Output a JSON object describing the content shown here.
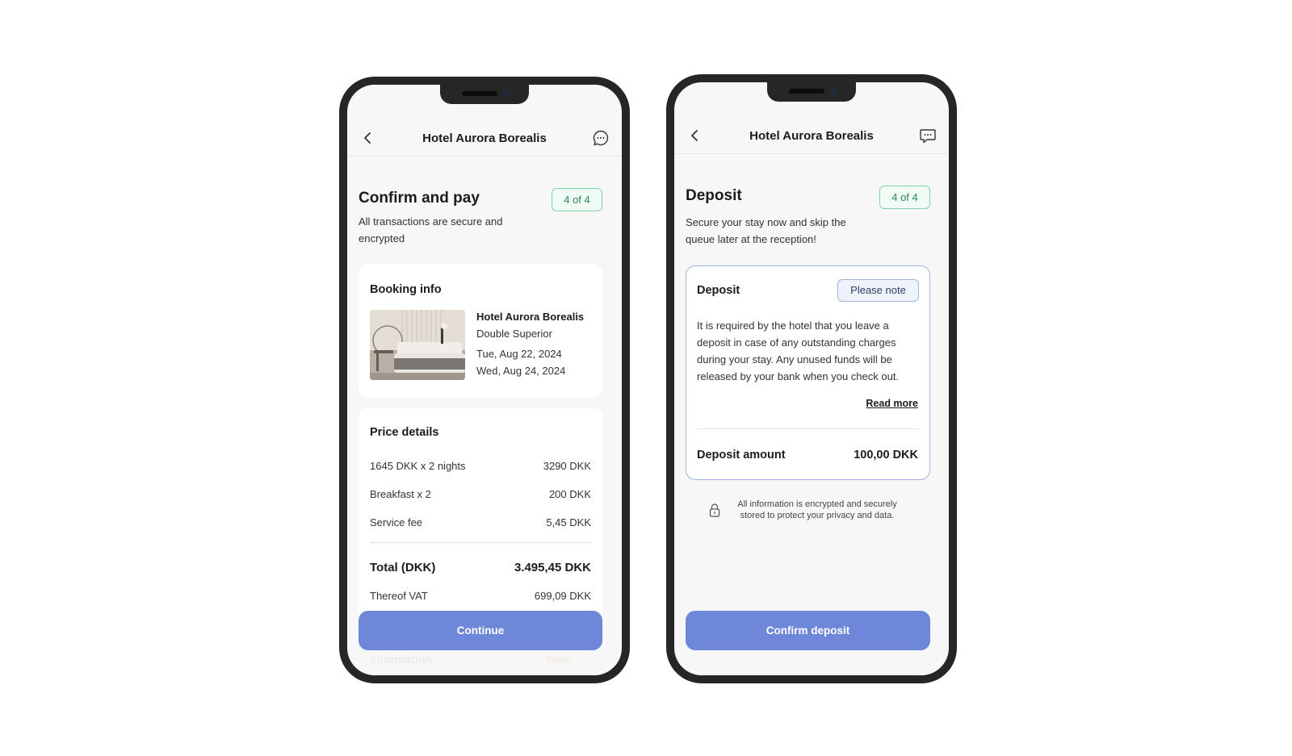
{
  "screen_confirm": {
    "header_title": "Hotel Aurora Borealis",
    "heading": "Confirm and pay",
    "step_label": "4 of 4",
    "subtitle": "All transactions are secure and encrypted",
    "booking": {
      "title": "Booking info",
      "hotel_name": "Hotel Aurora Borealis",
      "room_type": "Double Superior",
      "checkin": "Tue, Aug 22, 2024",
      "checkout": "Wed, Aug 24, 2024"
    },
    "price": {
      "title": "Price details",
      "rows": [
        {
          "label": "1645 DKK x 2 nights",
          "value": "3290 DKK"
        },
        {
          "label": "Breakfast x 2",
          "value": "200 DKK"
        },
        {
          "label": "Service fee",
          "value": "5,45 DKK"
        }
      ],
      "total_label": "Total (DKK)",
      "total_value": "3.495,45 DKK",
      "vat_label": "Thereof VAT",
      "vat_value": "699,09 DKK"
    },
    "faded_section_label": "Information",
    "faded_badge": "Note!",
    "continue_label": "Continue"
  },
  "screen_deposit": {
    "header_title": "Hotel Aurora Borealis",
    "heading": "Deposit",
    "step_label": "4 of 4",
    "subtitle": "Secure your stay now and skip the queue later at the reception!",
    "card": {
      "title": "Deposit",
      "badge": "Please note",
      "body": "It is required by the hotel that you leave a deposit in case of any outstanding charges during your stay. Any unused funds will be released by your bank when you check out.",
      "read_more": "Read more",
      "amount_label": "Deposit amount",
      "amount_value": "100,00 DKK"
    },
    "security_note": "All information is encrypted and securely stored to protect your privacy and data.",
    "confirm_label": "Confirm deposit"
  },
  "colors": {
    "primary_button": "#6f87d9",
    "step_badge_border": "#7fd3a5",
    "note_badge_border": "#9fb6e0",
    "phone_frame": "#262626"
  },
  "icons": [
    "chevron-left-icon",
    "chat-bubble-icon",
    "lock-icon"
  ]
}
